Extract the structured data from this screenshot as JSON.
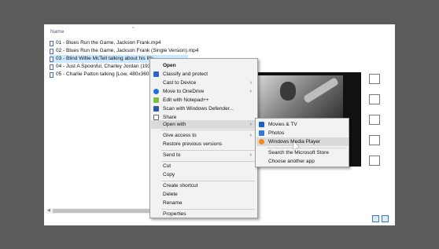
{
  "explorer": {
    "column_name": "Name",
    "files": [
      {
        "name": "01 - Blues Run the Game, Jackson Frank.mp4",
        "selected": false
      },
      {
        "name": "02 - Blues Run the Game, Jackson Frank (Single Version).mp4",
        "selected": false
      },
      {
        "name": "03 - Blind Willie McTell talking about his life...",
        "selected": true
      },
      {
        "name": "04 - Just A Spoonful, Charley Jordan (1930).m...",
        "selected": false
      },
      {
        "name": "05 - Charlie Patton talking [Low, 480x360p].m...",
        "selected": false
      }
    ]
  },
  "context_menu": {
    "open": "Open",
    "classify": "Classify and protect",
    "cast": "Cast to Device",
    "onedrive": "Move to OneDrive",
    "notepad": "Edit with Notepad++",
    "defender": "Scan with Windows Defender...",
    "share": "Share",
    "open_with": "Open with",
    "give_access": "Give access to",
    "restore": "Restore previous versions",
    "send_to": "Send to",
    "cut": "Cut",
    "copy": "Copy",
    "create_shortcut": "Create shortcut",
    "delete": "Delete",
    "rename": "Rename",
    "properties": "Properties"
  },
  "open_with_submenu": {
    "movies_tv": "Movies & TV",
    "photos": "Photos",
    "wmp": "Windows Media Player",
    "store": "Search the Microsoft Store",
    "choose": "Choose another app"
  },
  "colors": {
    "selection": "#cce8ff",
    "menu_bg": "#f2f2f2",
    "hover": "#dadada"
  }
}
